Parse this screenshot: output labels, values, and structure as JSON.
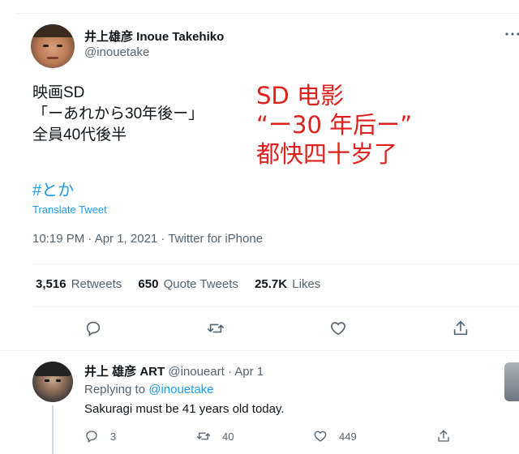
{
  "tweet": {
    "author": {
      "name": "井上雄彦 Inoue Takehiko",
      "handle": "@inouetake"
    },
    "text": "映画SD\n「ーあれから30年後ー」\n全員40代後半",
    "annotation": "SD 电影\n“ー30 年后ー”\n都快四十岁了",
    "hashtag": "#とか",
    "translate_label": "Translate Tweet",
    "meta": "10:19 PM · Apr 1, 2021 · Twitter for iPhone",
    "stats": {
      "retweets_count": "3,516",
      "retweets_label": "Retweets",
      "quotes_count": "650",
      "quotes_label": "Quote Tweets",
      "likes_count": "25.7K",
      "likes_label": "Likes"
    },
    "actions": [
      "reply-icon",
      "retweet-icon",
      "like-icon",
      "share-icon"
    ]
  },
  "reply": {
    "name": "井上 雄彦 ART",
    "handle_date": "@inoueart · Apr 1",
    "replying_prefix": "Replying to",
    "replying_handle": "@inouetake",
    "text": "Sakuragi must be 41 years old today.",
    "counts": {
      "replies": "3",
      "retweets": "40",
      "likes": "449"
    }
  },
  "colors": {
    "link": "#1d9bf0",
    "secondary_text": "#536471",
    "annotation": "#e0201b"
  }
}
